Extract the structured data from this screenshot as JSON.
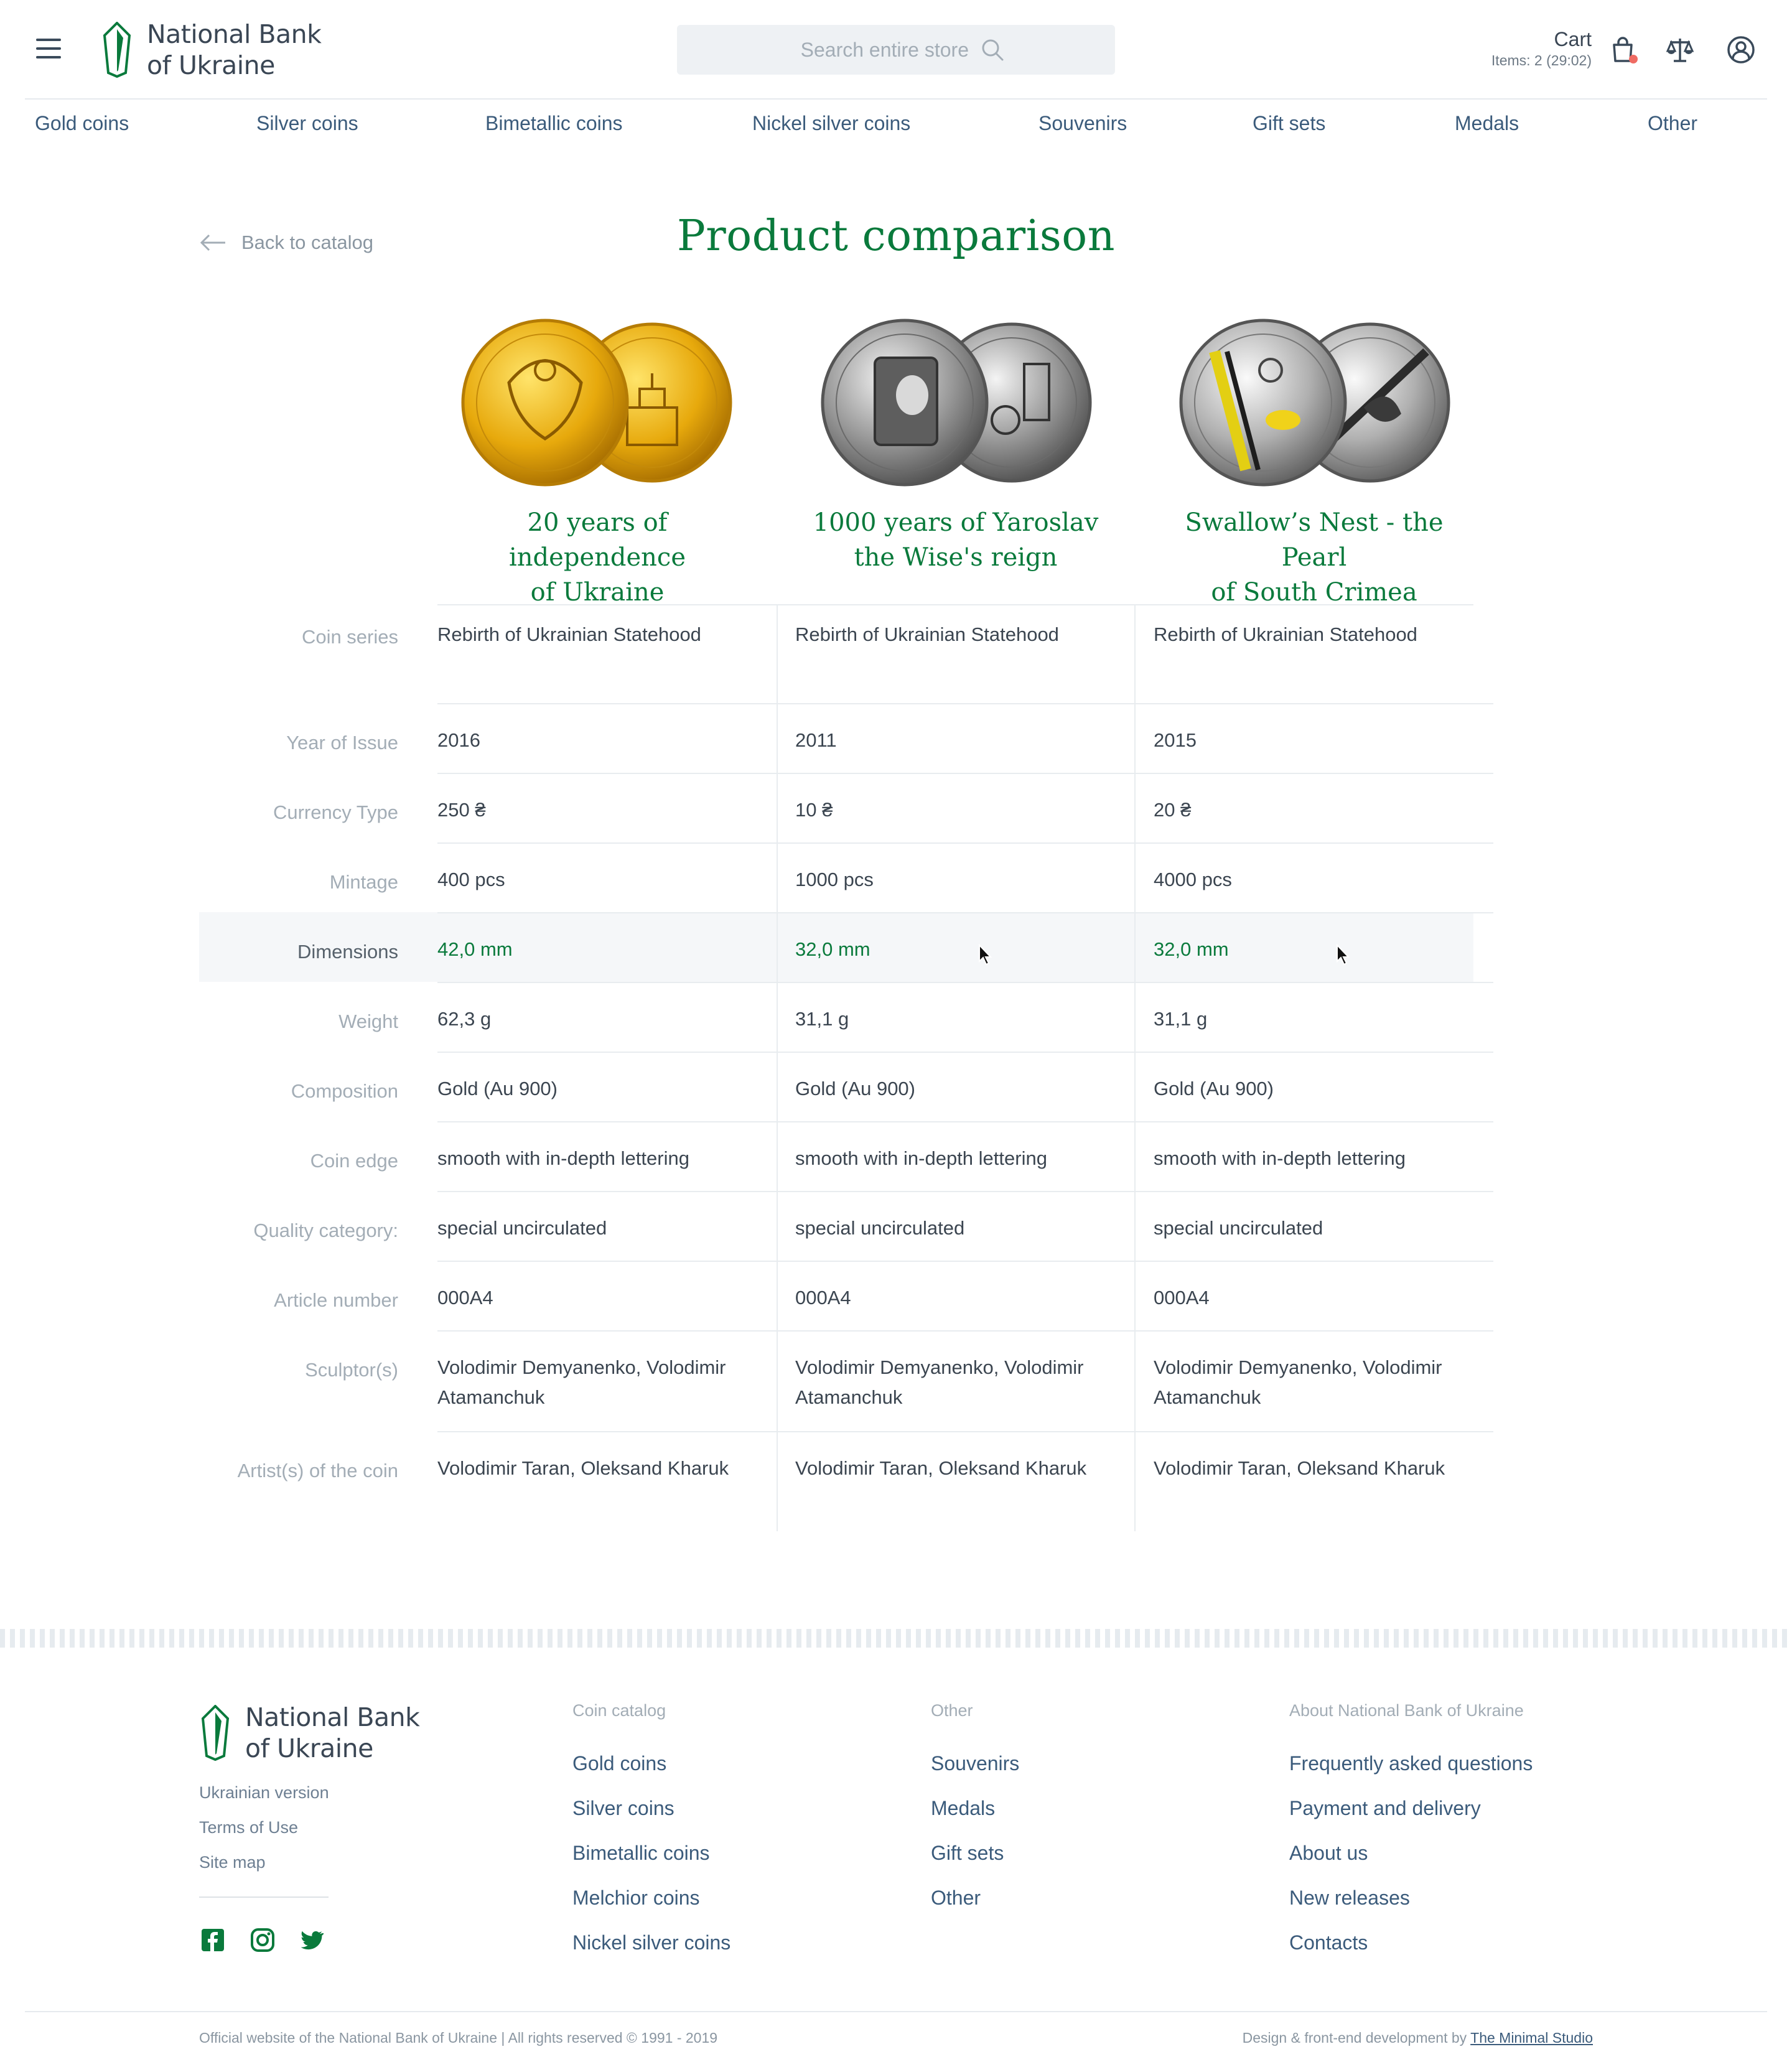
{
  "brand": {
    "line1": "National Bank",
    "line2": "of Ukraine"
  },
  "search": {
    "placeholder": "Search entire store"
  },
  "cart": {
    "title": "Cart",
    "items": "Items: 2 (29:02)"
  },
  "colors": {
    "accent": "#0a7a3c",
    "link": "#3b5b7b",
    "cart_dot": "#ef6b63"
  },
  "nav": [
    "Gold coins",
    "Silver coins",
    "Bimetallic coins",
    "Nickel silver coins",
    "Souvenirs",
    "Gift sets",
    "Medals",
    "Other"
  ],
  "page": {
    "back_label": "Back to catalog",
    "title": "Product comparison"
  },
  "products": [
    {
      "title_line1": "20 years of independence",
      "title_line2": "of Ukraine",
      "image": "gold-coin-pair"
    },
    {
      "title_line1": "1000 years of Yaroslav",
      "title_line2": "the Wise's reign",
      "image": "silver-coin-pair"
    },
    {
      "title_line1": "Swallow’s Nest - the Pearl",
      "title_line2": "of South Crimea",
      "image": "silver-yellow-coin-pair"
    }
  ],
  "rows": [
    {
      "label": "Coin series",
      "values": [
        "Rebirth of Ukrainian Statehood",
        "Rebirth of Ukrainian Statehood",
        "Rebirth of Ukrainian Statehood"
      ]
    },
    {
      "label": "Year of Issue",
      "values": [
        "2016",
        "2011",
        "2015"
      ]
    },
    {
      "label": "Currency Type",
      "values": [
        "250 ₴",
        "10 ₴",
        "20 ₴"
      ]
    },
    {
      "label": "Mintage",
      "values": [
        "400 pcs",
        "1000 pcs",
        "4000 pcs"
      ]
    },
    {
      "label": "Dimensions",
      "values": [
        "42,0 mm",
        "32,0 mm",
        "32,0 mm"
      ],
      "highlighted": true
    },
    {
      "label": "Weight",
      "values": [
        "62,3 g",
        "31,1 g",
        "31,1 g"
      ]
    },
    {
      "label": "Composition",
      "values": [
        "Gold (Au 900)",
        "Gold (Au 900)",
        "Gold (Au 900)"
      ]
    },
    {
      "label": "Coin edge",
      "values": [
        "smooth with in-depth lettering",
        "smooth with in-depth lettering",
        "smooth with in-depth lettering"
      ]
    },
    {
      "label": "Quality category:",
      "values": [
        "special uncirculated",
        "special uncirculated",
        "special uncirculated"
      ]
    },
    {
      "label": "Article number",
      "values": [
        "000A4",
        "000A4",
        "000A4"
      ]
    },
    {
      "label": "Sculptor(s)",
      "values": [
        [
          "Volodimir Demyanenko, Volodimir",
          "Atamanchuk"
        ],
        [
          "Volodimir Demyanenko, Volodimir",
          "Atamanchuk"
        ],
        [
          "Volodimir Demyanenko, Volodimir",
          "Atamanchuk"
        ]
      ]
    },
    {
      "label": "Artist(s) of the coin",
      "values": [
        "Volodimir Taran, Oleksand Kharuk",
        "Volodimir Taran, Oleksand Kharuk",
        "Volodimir Taran, Oleksand Kharuk"
      ]
    }
  ],
  "footer": {
    "side_links": [
      "Ukrainian version",
      "Terms of Use",
      "Site map"
    ],
    "social": [
      "facebook-icon",
      "instagram-icon",
      "twitter-icon"
    ],
    "columns": [
      {
        "title": "Coin catalog",
        "links": [
          "Gold coins",
          "Silver coins",
          "Bimetallic coins",
          "Melchior coins",
          "Nickel silver coins"
        ]
      },
      {
        "title": "Other",
        "links": [
          "Souvenirs",
          "Medals",
          "Gift sets",
          "Other"
        ]
      },
      {
        "title": "About National Bank of Ukraine",
        "links": [
          "Frequently asked questions",
          "Payment and delivery",
          "About us",
          "New releases",
          "Contacts"
        ]
      }
    ],
    "copyright": "Official website of the National Bank of Ukraine | All rights reserved © 1991 - 2019",
    "credit_prefix": "Design & front-end development by",
    "credit_link": "The Minimal Studio"
  }
}
